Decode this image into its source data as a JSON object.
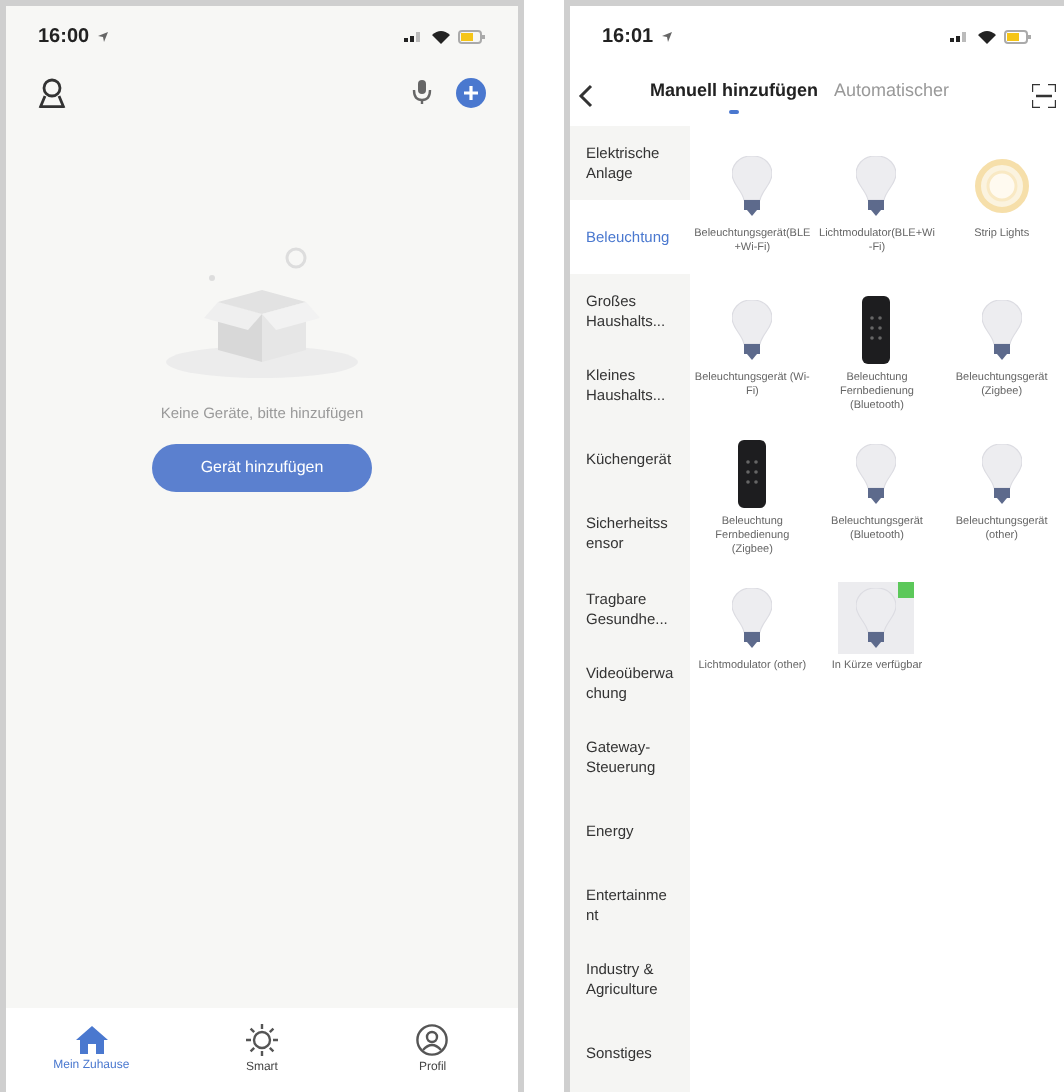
{
  "home_screen": {
    "status_bar": {
      "time": "16:00"
    },
    "empty_state": {
      "message": "Keine Geräte, bitte hinzufügen",
      "button": "Gerät hinzufügen"
    },
    "bottom_nav": [
      {
        "label": "Mein Zuhause",
        "kind": "home",
        "selected": true
      },
      {
        "label": "Smart",
        "kind": "smart",
        "selected": false
      },
      {
        "label": "Profil",
        "kind": "profile",
        "selected": false
      }
    ]
  },
  "add_screen": {
    "status_bar": {
      "time": "16:01"
    },
    "tabs": [
      {
        "label": "Manuell hinzufügen",
        "selected": true
      },
      {
        "label": "Automatischer",
        "selected": false
      }
    ],
    "categories": [
      {
        "label": "Elektrische Anlage",
        "selected": false
      },
      {
        "label": "Beleuchtung",
        "selected": true
      },
      {
        "label": "Großes Haushalts...",
        "selected": false
      },
      {
        "label": "Kleines Haushalts...",
        "selected": false
      },
      {
        "label": "Küchengerät",
        "selected": false
      },
      {
        "label": "Sicherheitssensor",
        "selected": false
      },
      {
        "label": "Tragbare Gesundhe...",
        "selected": false
      },
      {
        "label": "Videoüberwachung",
        "selected": false
      },
      {
        "label": "Gateway-Steuerung",
        "selected": false
      },
      {
        "label": "Energy",
        "selected": false
      },
      {
        "label": "Entertainment",
        "selected": false
      },
      {
        "label": "Industry & Agriculture",
        "selected": false
      },
      {
        "label": "Sonstiges",
        "selected": false
      }
    ],
    "devices": [
      {
        "label": "Beleuchtungsgerät(BLE+Wi-Fi)",
        "kind": "bulb",
        "highlighted": false
      },
      {
        "label": "Lichtmodulator(BLE+Wi-Fi)",
        "kind": "bulb",
        "highlighted": false
      },
      {
        "label": "Strip Lights",
        "kind": "ring",
        "highlighted": false
      },
      {
        "label": "Beleuchtungsgerät (Wi-Fi)",
        "kind": "bulb",
        "highlighted": false
      },
      {
        "label": "Beleuchtung Fernbedienung (Bluetooth)",
        "kind": "remote",
        "highlighted": false
      },
      {
        "label": "Beleuchtungsgerät (Zigbee)",
        "kind": "bulb",
        "highlighted": false
      },
      {
        "label": "Beleuchtung Fernbedienung (Zigbee)",
        "kind": "remote",
        "highlighted": false
      },
      {
        "label": "Beleuchtungsgerät (Bluetooth)",
        "kind": "bulb",
        "highlighted": false
      },
      {
        "label": "Beleuchtungsgerät (other)",
        "kind": "bulb",
        "highlighted": false
      },
      {
        "label": "Lichtmodulator (other)",
        "kind": "bulb",
        "highlighted": false
      },
      {
        "label": "In Kürze verfügbar",
        "kind": "bulb",
        "highlighted": true
      }
    ]
  }
}
